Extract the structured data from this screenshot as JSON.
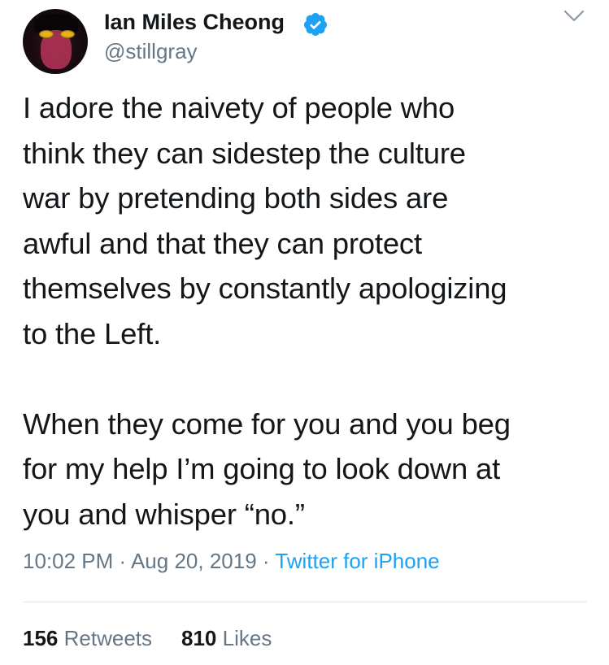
{
  "user": {
    "name": "Ian Miles Cheong",
    "handle": "@stillgray",
    "verified": true
  },
  "tweet": {
    "text": "I adore the naivety of people who\nthink they can sidestep the culture\nwar by pretending both sides are\nawful and that they can protect\nthemselves by constantly apologizing\nto the Left.\n\nWhen they come for you and you beg\nfor my help I’m going to look down at\nyou and whisper “no.”",
    "time": "10:02 PM",
    "separator": " · ",
    "date": "Aug 20, 2019",
    "source": "Twitter for iPhone"
  },
  "stats": {
    "retweets_count": "156",
    "retweets_label": "Retweets",
    "likes_count": "810",
    "likes_label": "Likes"
  },
  "icons": {
    "verified": "verified-badge-icon",
    "menu": "chevron-down-icon"
  },
  "colors": {
    "text": "#14171a",
    "secondary": "#657786",
    "link": "#1da1f2",
    "divider": "#e1e8ed"
  }
}
